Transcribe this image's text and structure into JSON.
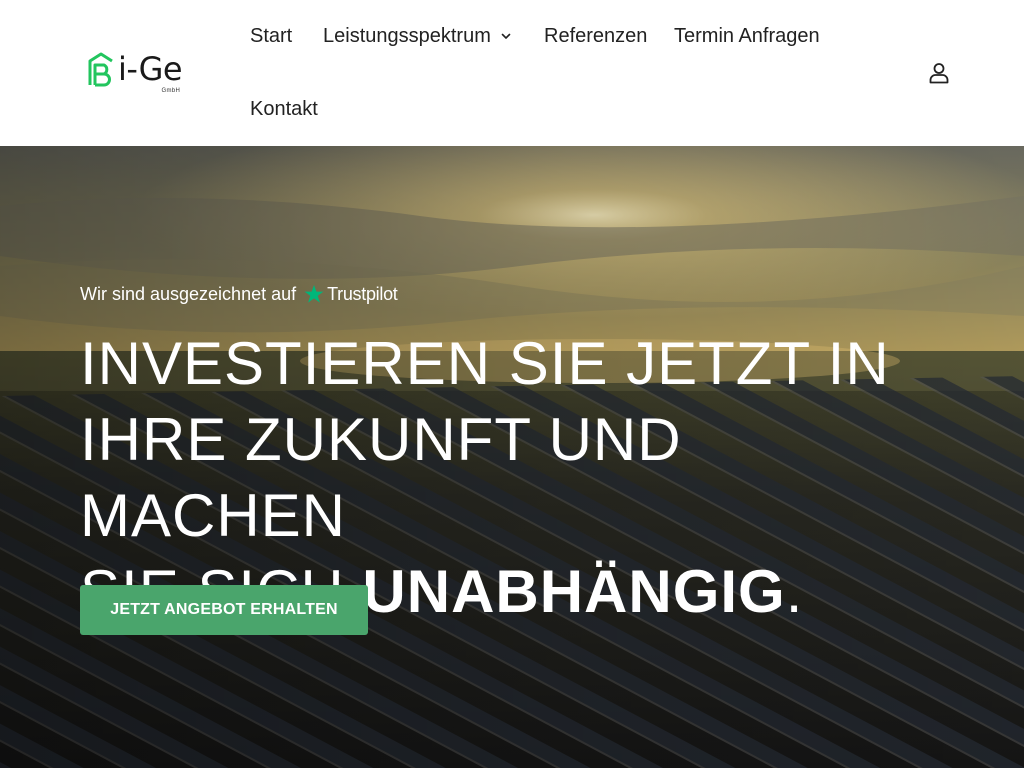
{
  "header": {
    "logo": {
      "text": "i-Ge",
      "subtext": "GmbH",
      "mark_color": "#22c55e"
    },
    "nav": [
      {
        "label": "Start"
      },
      {
        "label": "Leistungsspektrum",
        "has_dropdown": true
      },
      {
        "label": "Referenzen"
      },
      {
        "label": "Termin Anfragen"
      },
      {
        "label": "Kontakt"
      }
    ],
    "user_icon": "user-icon"
  },
  "hero": {
    "award_text": "Wir sind ausgezeichnet auf",
    "trustpilot": {
      "name": "Trustpilot",
      "star_color": "#00b67a"
    },
    "headline": {
      "line1": "INVESTIEREN SIE JETZT IN",
      "line2": "IHRE ZUKUNFT UND MACHEN",
      "line3_prefix": "SIE SICH ",
      "line3_bold": "UNABHÄNGIG",
      "line3_suffix": "."
    },
    "cta_label": "JETZT ANGEBOT ERHALTEN",
    "cta_color": "#4aa56c"
  }
}
